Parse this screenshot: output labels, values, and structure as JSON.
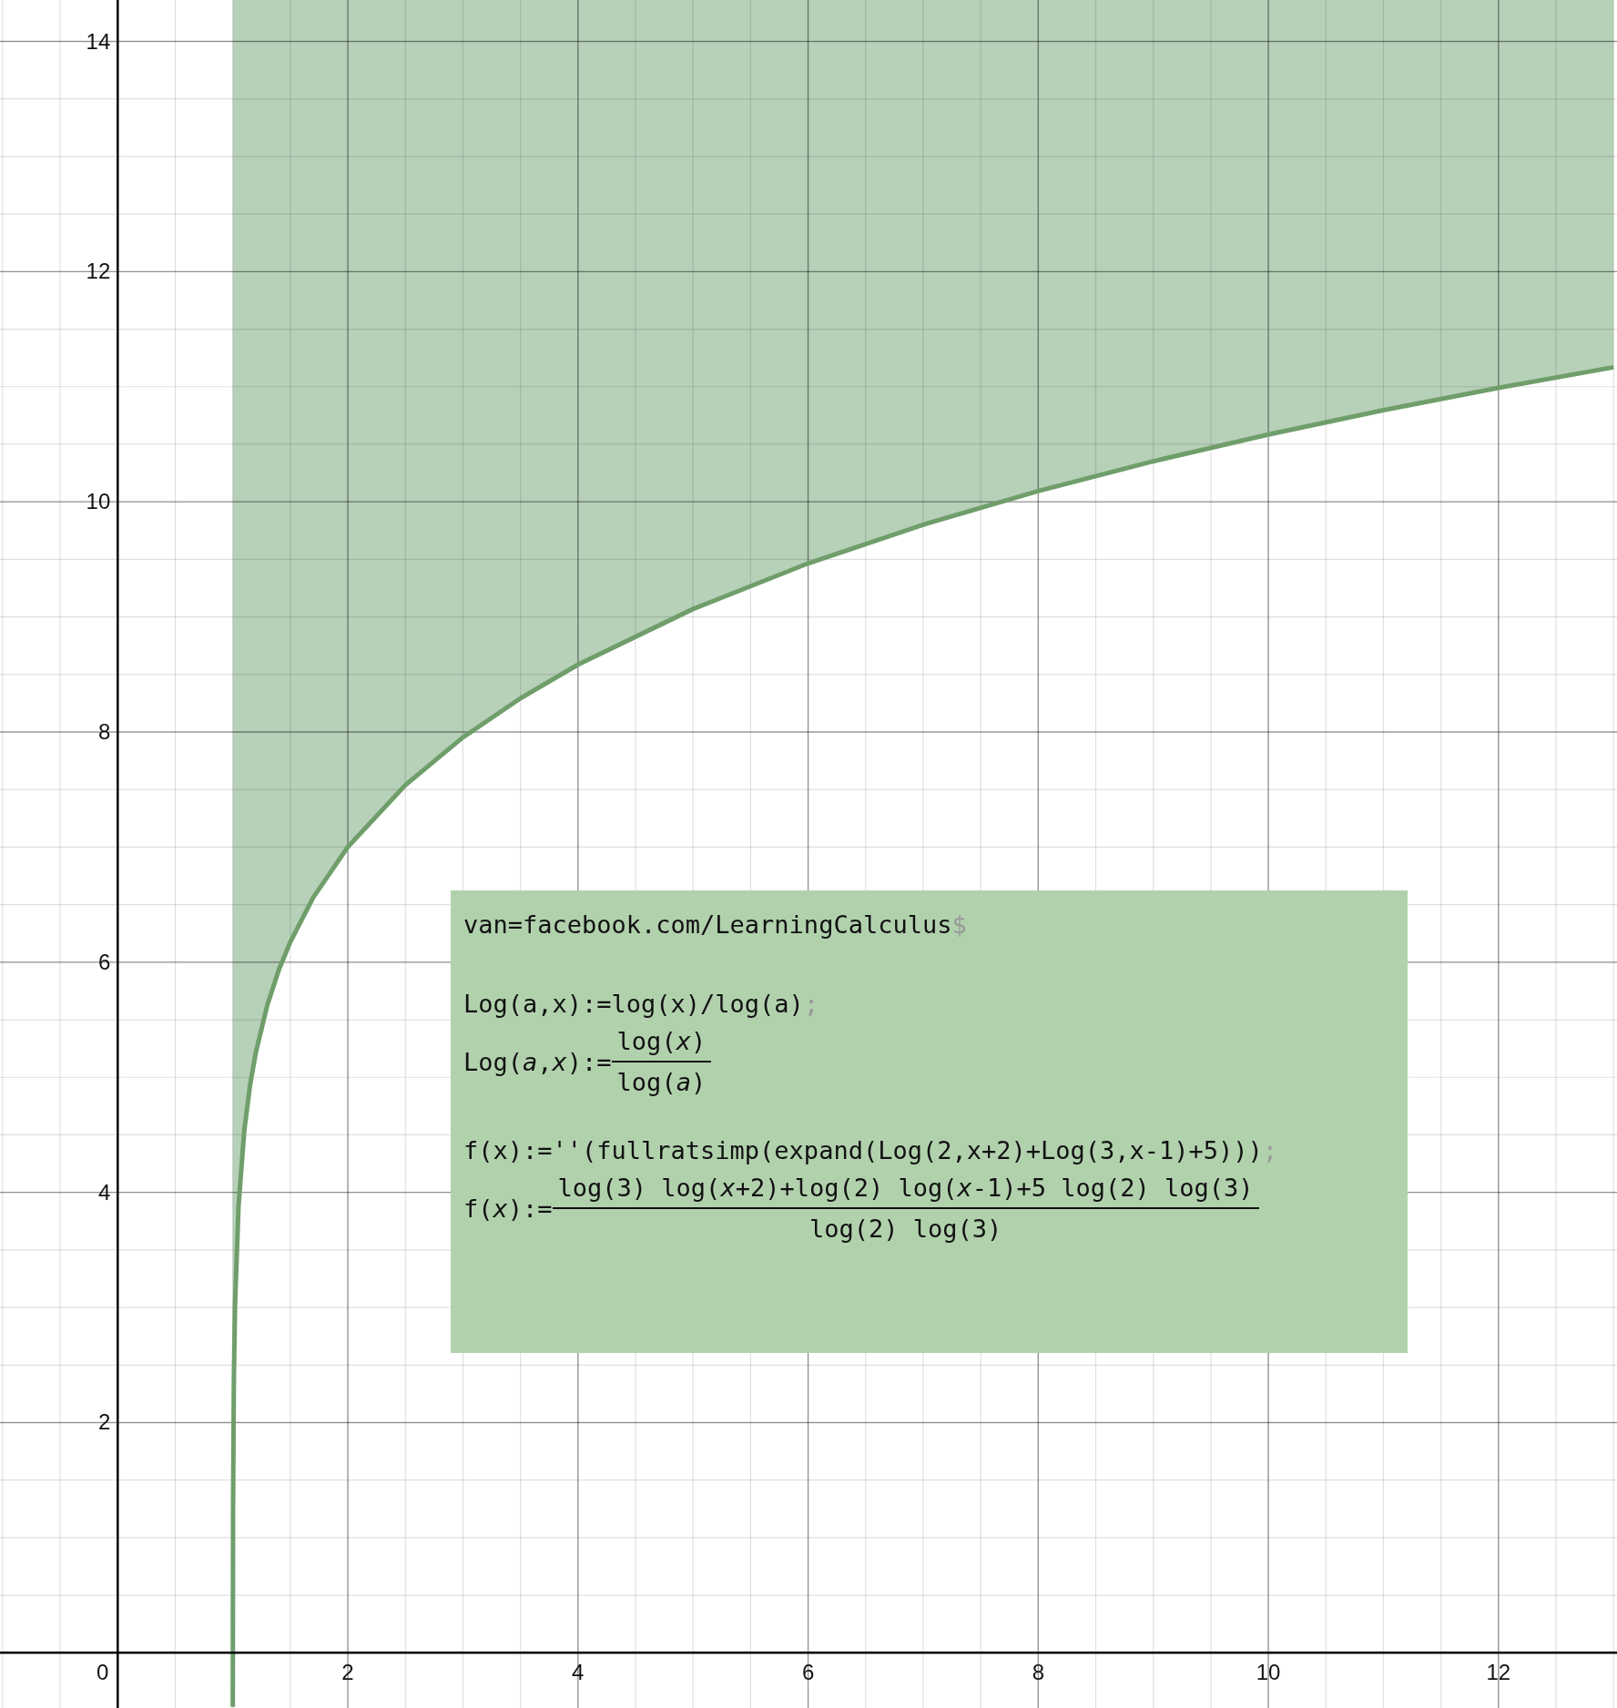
{
  "graph": {
    "origin_label": "0",
    "chart_data": {
      "type": "line",
      "xlim": [
        -1.023,
        13.03
      ],
      "ylim": [
        -0.48,
        14.36
      ],
      "grid": true,
      "xticks": [
        2,
        4,
        6,
        8,
        10,
        12
      ],
      "yticks": [
        2,
        4,
        6,
        8,
        10,
        12,
        14
      ],
      "x": [
        1.00043,
        1.001,
        1.003,
        1.01,
        1.02,
        1.05,
        1.1,
        1.15,
        1.2,
        1.3,
        1.4,
        1.5,
        1.7,
        2,
        2.5,
        3,
        3.5,
        4,
        5,
        6,
        7,
        8,
        9,
        10,
        11,
        12,
        13
      ],
      "series": [
        {
          "color": "#6f9e6a",
          "values": [
            -0.47,
            0.298,
            1.299,
            2.398,
            3.034,
            3.882,
            4.536,
            4.929,
            5.213,
            5.627,
            5.932,
            6.177,
            6.563,
            7,
            7.539,
            7.953,
            8.293,
            8.585,
            9.069,
            9.465,
            9.801,
            10.093,
            10.352,
            10.585,
            10.796,
            10.99,
            11.169
          ]
        }
      ]
    }
  },
  "console": {
    "entries": [
      {
        "kind": "input",
        "code": "van=facebook.com/LearningCalculus",
        "terminator": "$"
      },
      {
        "kind": "input",
        "code": "Log(a,x):=log(x)/log(a)",
        "terminator": ";"
      },
      {
        "kind": "output",
        "lhs": "Log(*a*,*x*):=",
        "numerator": "log(*x*)",
        "denominator": "log(*a*)"
      },
      {
        "kind": "input",
        "code": "f(x):=''(fullratsimp(expand(Log(2,x+2)+Log(3,x-1)+5)))",
        "terminator": ";"
      },
      {
        "kind": "output",
        "lhs": "f(*x*):=",
        "numerator": "log(3) log(*x*+2)+log(2) log(*x*-1)+5 log(2) log(3)",
        "denominator": "log(2) log(3)"
      }
    ]
  }
}
